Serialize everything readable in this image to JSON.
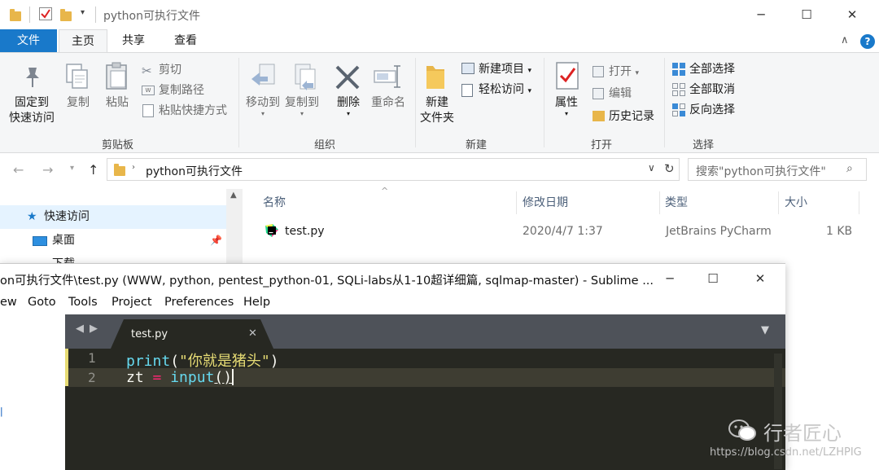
{
  "explorer": {
    "title": "python可执行文件",
    "tabs": {
      "file": "文件",
      "home": "主页",
      "share": "共享",
      "view": "查看"
    },
    "ribbon": {
      "clipboard": {
        "group": "剪贴板",
        "pin_l1": "固定到",
        "pin_l2": "快速访问",
        "copy": "复制",
        "paste": "粘贴",
        "cut": "剪切",
        "copy_path": "复制路径",
        "paste_shortcut": "粘贴快捷方式"
      },
      "organize": {
        "group": "组织",
        "move_to": "移动到",
        "copy_to": "复制到",
        "delete": "删除",
        "rename": "重命名"
      },
      "new": {
        "group": "新建",
        "new_folder_l1": "新建",
        "new_folder_l2": "文件夹",
        "new_item": "新建项目",
        "easy_access": "轻松访问"
      },
      "open": {
        "group": "打开",
        "properties": "属性",
        "open": "打开",
        "edit": "编辑",
        "history": "历史记录"
      },
      "select": {
        "group": "选择",
        "select_all": "全部选择",
        "select_none": "全部取消",
        "invert": "反向选择"
      }
    },
    "address": {
      "path": "python可执行文件",
      "search_placeholder": "搜索\"python可执行文件\""
    },
    "nav": {
      "quick_access": "快速访问",
      "desktop": "桌面",
      "downloads": "下载"
    },
    "columns": {
      "name": "名称",
      "modified": "修改日期",
      "type": "类型",
      "size": "大小"
    },
    "files": [
      {
        "name": "test.py",
        "modified": "2020/4/7 1:37",
        "type": "JetBrains PyCharm",
        "size": "1 KB"
      }
    ]
  },
  "sublime": {
    "title": "on可执行文件\\test.py (WWW, python, pentest_python-01, SQLi-labs从1-10超详细篇, sqlmap-master) - Sublime ...",
    "menu": [
      "ew",
      "Goto",
      "Tools",
      "Project",
      "Preferences",
      "Help"
    ],
    "tab": "test.py",
    "lines": [
      {
        "no": "1",
        "fn": "print",
        "open": "(",
        "str": "\"你就是猪头\"",
        "close": ")"
      },
      {
        "no": "2",
        "var": "zt ",
        "op": "=",
        "fn": " input",
        "parens": "()"
      }
    ]
  },
  "watermark": {
    "brand": "行者匠心",
    "url": "https://blog.csdn.net/LZHPIG"
  },
  "colors": {
    "accent": "#1979ca",
    "editor_bg": "#272822",
    "tabbar_bg": "#4e5259"
  }
}
